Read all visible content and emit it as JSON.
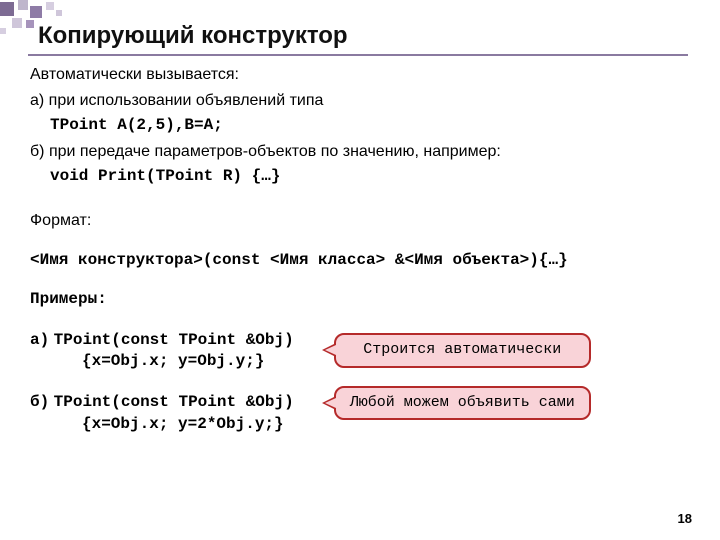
{
  "title": "Копирующий конструктор",
  "intro": {
    "line1": "Автоматически вызывается:",
    "line2": "а) при использовании объявлений типа",
    "code1": "TPoint A(2,5),B=A;",
    "line3": "б) при передаче параметров-объектов по значению, например:",
    "code2": "void Print(TPoint R) {…}"
  },
  "format_label": "Формат:",
  "format_code": "<Имя конструктора>(const <Имя класса> &<Имя объекта>){…}",
  "examples_label": "Примеры:",
  "examples": {
    "a_label": "а)",
    "a_sig": "TPoint(const TPoint &Obj)",
    "a_body": "{x=Obj.x; y=Obj.y;}",
    "b_label": "б)",
    "b_sig": "TPoint(const TPoint &Obj)",
    "b_body": "{x=Obj.x; y=2*Obj.y;}"
  },
  "bubbles": {
    "auto": "Строится автоматически",
    "manual": "Любой можем объявить сами"
  },
  "page_number": "18"
}
